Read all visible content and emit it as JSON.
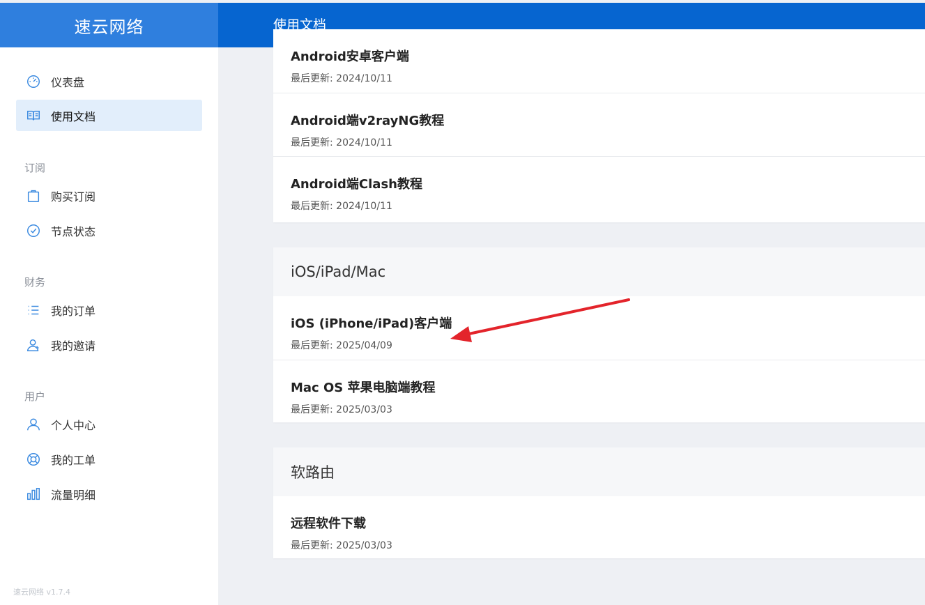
{
  "header": {
    "brand": "速云网络",
    "title": "使用文档"
  },
  "sidebar": {
    "items": [
      {
        "label": "仪表盘",
        "icon": "dashboard-icon"
      },
      {
        "label": "使用文档",
        "icon": "book-icon",
        "active": true
      }
    ],
    "sections": [
      {
        "label": "订阅",
        "items": [
          {
            "label": "购买订阅",
            "icon": "shopping-bag-icon"
          },
          {
            "label": "节点状态",
            "icon": "check-circle-icon"
          }
        ]
      },
      {
        "label": "财务",
        "items": [
          {
            "label": "我的订单",
            "icon": "list-icon"
          },
          {
            "label": "我的邀请",
            "icon": "users-icon"
          }
        ]
      },
      {
        "label": "用户",
        "items": [
          {
            "label": "个人中心",
            "icon": "user-icon"
          },
          {
            "label": "我的工单",
            "icon": "lifebuoy-icon"
          },
          {
            "label": "流量明细",
            "icon": "bar-chart-icon"
          }
        ]
      }
    ],
    "version": "速云网络 v1.7.4"
  },
  "main": {
    "groups": [
      {
        "title": "",
        "items": [
          {
            "title": "Android安卓客户端",
            "date": "最后更新: 2024/10/11"
          },
          {
            "title": "Android端v2rayNG教程",
            "date": "最后更新: 2024/10/11"
          },
          {
            "title": "Android端Clash教程",
            "date": "最后更新: 2024/10/11"
          }
        ]
      },
      {
        "title": "iOS/iPad/Mac",
        "items": [
          {
            "title": "iOS (iPhone/iPad)客户端",
            "date": "最后更新: 2025/04/09"
          },
          {
            "title": "Mac OS 苹果电脑端教程",
            "date": "最后更新: 2025/03/03"
          }
        ]
      },
      {
        "title": "软路由",
        "items": [
          {
            "title": "远程软件下载",
            "date": "最后更新: 2025/03/03"
          }
        ]
      }
    ]
  },
  "colors": {
    "header": "#0665d0",
    "brand_bg": "#2f7fde",
    "active_nav": "#e2eefb",
    "icon": "#3b8ae0",
    "arrow": "#e3242b"
  }
}
